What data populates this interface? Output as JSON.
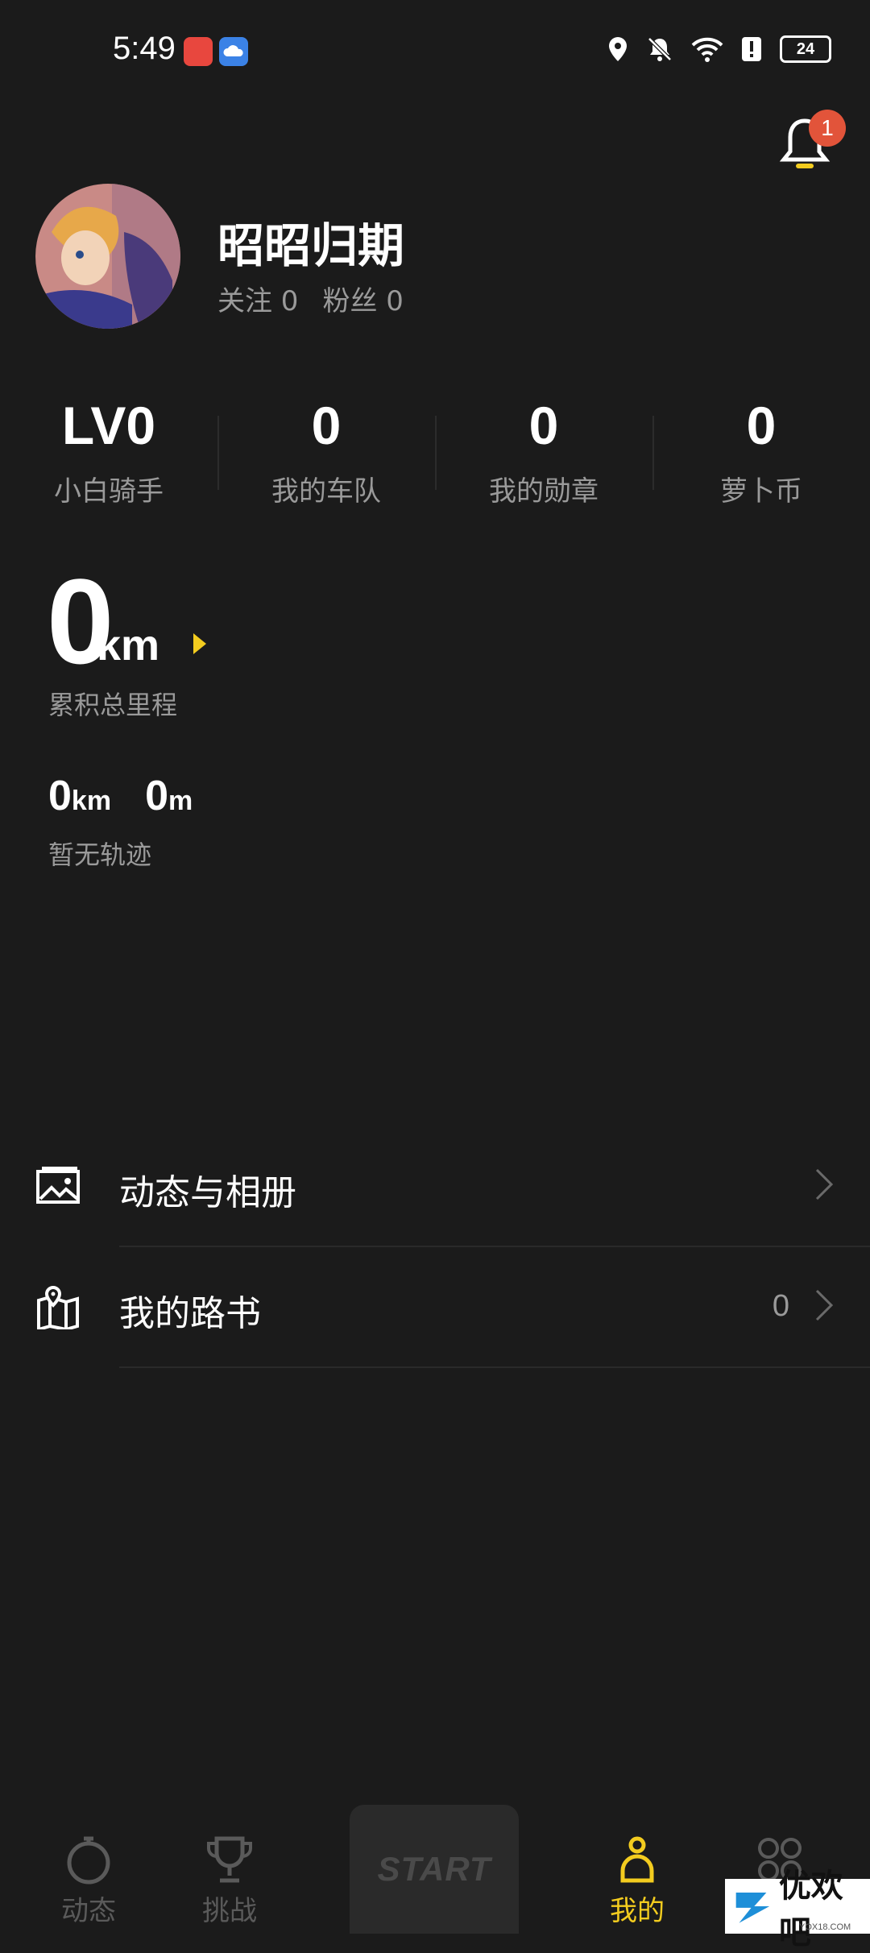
{
  "status_bar": {
    "time": "5:49",
    "battery": "24"
  },
  "notifications": {
    "badge": "1"
  },
  "profile": {
    "username": "昭昭归期",
    "follow_label": "关注 0",
    "fans_label": "粉丝 0"
  },
  "stats": [
    {
      "value": "LV0",
      "label": "小白骑手"
    },
    {
      "value": "0",
      "label": "我的车队"
    },
    {
      "value": "0",
      "label": "我的勋章"
    },
    {
      "value": "0",
      "label": "萝卜币"
    }
  ],
  "total": {
    "value": "0",
    "unit": "km",
    "label": "累积总里程"
  },
  "sub_stats": {
    "distance_value": "0",
    "distance_unit": "km",
    "elevation_value": "0",
    "elevation_unit": "m",
    "no_track": "暂无轨迹"
  },
  "menu": {
    "album": {
      "label": "动态与相册"
    },
    "routes": {
      "label": "我的路书",
      "count": "0"
    }
  },
  "bottom_nav": {
    "items": [
      {
        "label": "动态"
      },
      {
        "label": "挑战"
      },
      {
        "label": "START"
      },
      {
        "label": "我的"
      },
      {
        "label": "更多"
      }
    ]
  },
  "watermark": {
    "text": "优欢吧",
    "url": "YOX18.COM"
  },
  "colors": {
    "background": "#1b1b1b",
    "accent": "#f3cc1f",
    "badge": "#e2543a",
    "muted": "#9a9a9a"
  }
}
